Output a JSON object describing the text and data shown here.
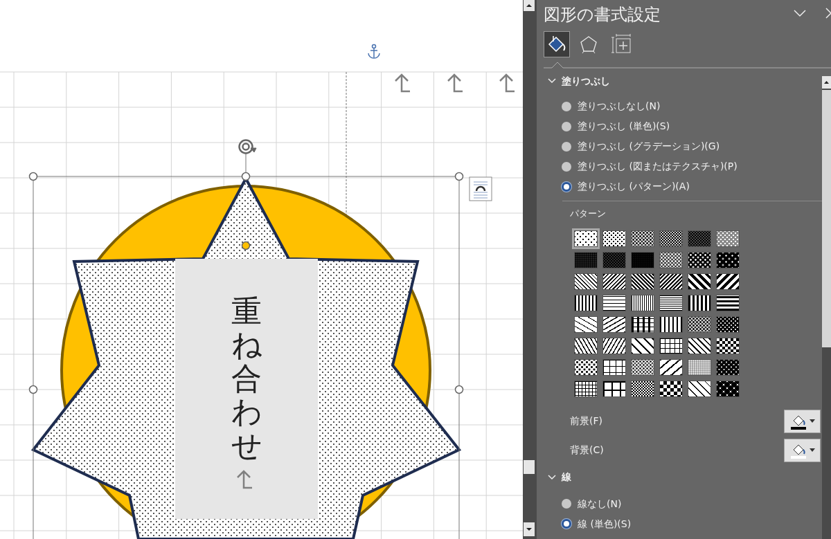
{
  "document": {
    "text_box": "重ね合わせ"
  },
  "format_pane": {
    "title": "図形の書式設定",
    "tabs": [
      {
        "kind": "fill",
        "selected": true
      },
      {
        "kind": "effects",
        "selected": false
      },
      {
        "kind": "layout",
        "selected": false
      }
    ],
    "sections": [
      {
        "title": "塗りつぶし",
        "expanded": true,
        "options": [
          {
            "label": "塗りつぶしなし(N)",
            "selected": false
          },
          {
            "label": "塗りつぶし (単色)(S)",
            "selected": false
          },
          {
            "label": "塗りつぶし (グラデーション)(G)",
            "selected": false
          },
          {
            "label": "塗りつぶし (図またはテクスチャ)(P)",
            "selected": false
          },
          {
            "label": "塗りつぶし (パターン)(A)",
            "selected": true
          }
        ],
        "pattern": {
          "label": "パターン",
          "swatches": [
            {
              "selected": true
            },
            {
              "selected": false
            },
            {
              "selected": false
            },
            {
              "selected": false
            },
            {
              "selected": false
            },
            {
              "selected": false
            },
            {
              "selected": false
            },
            {
              "selected": false
            },
            {
              "selected": false
            },
            {
              "selected": false
            },
            {
              "selected": false
            },
            {
              "selected": false
            },
            {
              "selected": false
            },
            {
              "selected": false
            },
            {
              "selected": false
            },
            {
              "selected": false
            },
            {
              "selected": false
            },
            {
              "selected": false
            },
            {
              "selected": false
            },
            {
              "selected": false
            },
            {
              "selected": false
            },
            {
              "selected": false
            },
            {
              "selected": false
            },
            {
              "selected": false
            },
            {
              "selected": false
            },
            {
              "selected": false
            },
            {
              "selected": false
            },
            {
              "selected": false
            },
            {
              "selected": false
            },
            {
              "selected": false
            },
            {
              "selected": false
            },
            {
              "selected": false
            },
            {
              "selected": false
            },
            {
              "selected": false
            },
            {
              "selected": false
            },
            {
              "selected": false
            },
            {
              "selected": false
            },
            {
              "selected": false
            },
            {
              "selected": false
            },
            {
              "selected": false
            },
            {
              "selected": false
            },
            {
              "selected": false
            },
            {
              "selected": false
            },
            {
              "selected": false
            },
            {
              "selected": false
            },
            {
              "selected": false
            },
            {
              "selected": false
            },
            {
              "selected": false
            }
          ]
        },
        "colors": [
          {
            "label": "前景(F)",
            "color": "#000000"
          },
          {
            "label": "背景(C)",
            "color": "#ffffff"
          }
        ]
      },
      {
        "title": "線",
        "expanded": true,
        "options": [
          {
            "label": "線なし(N)",
            "selected": false
          },
          {
            "label": "線 (単色)(S)",
            "selected": true
          }
        ]
      }
    ]
  }
}
